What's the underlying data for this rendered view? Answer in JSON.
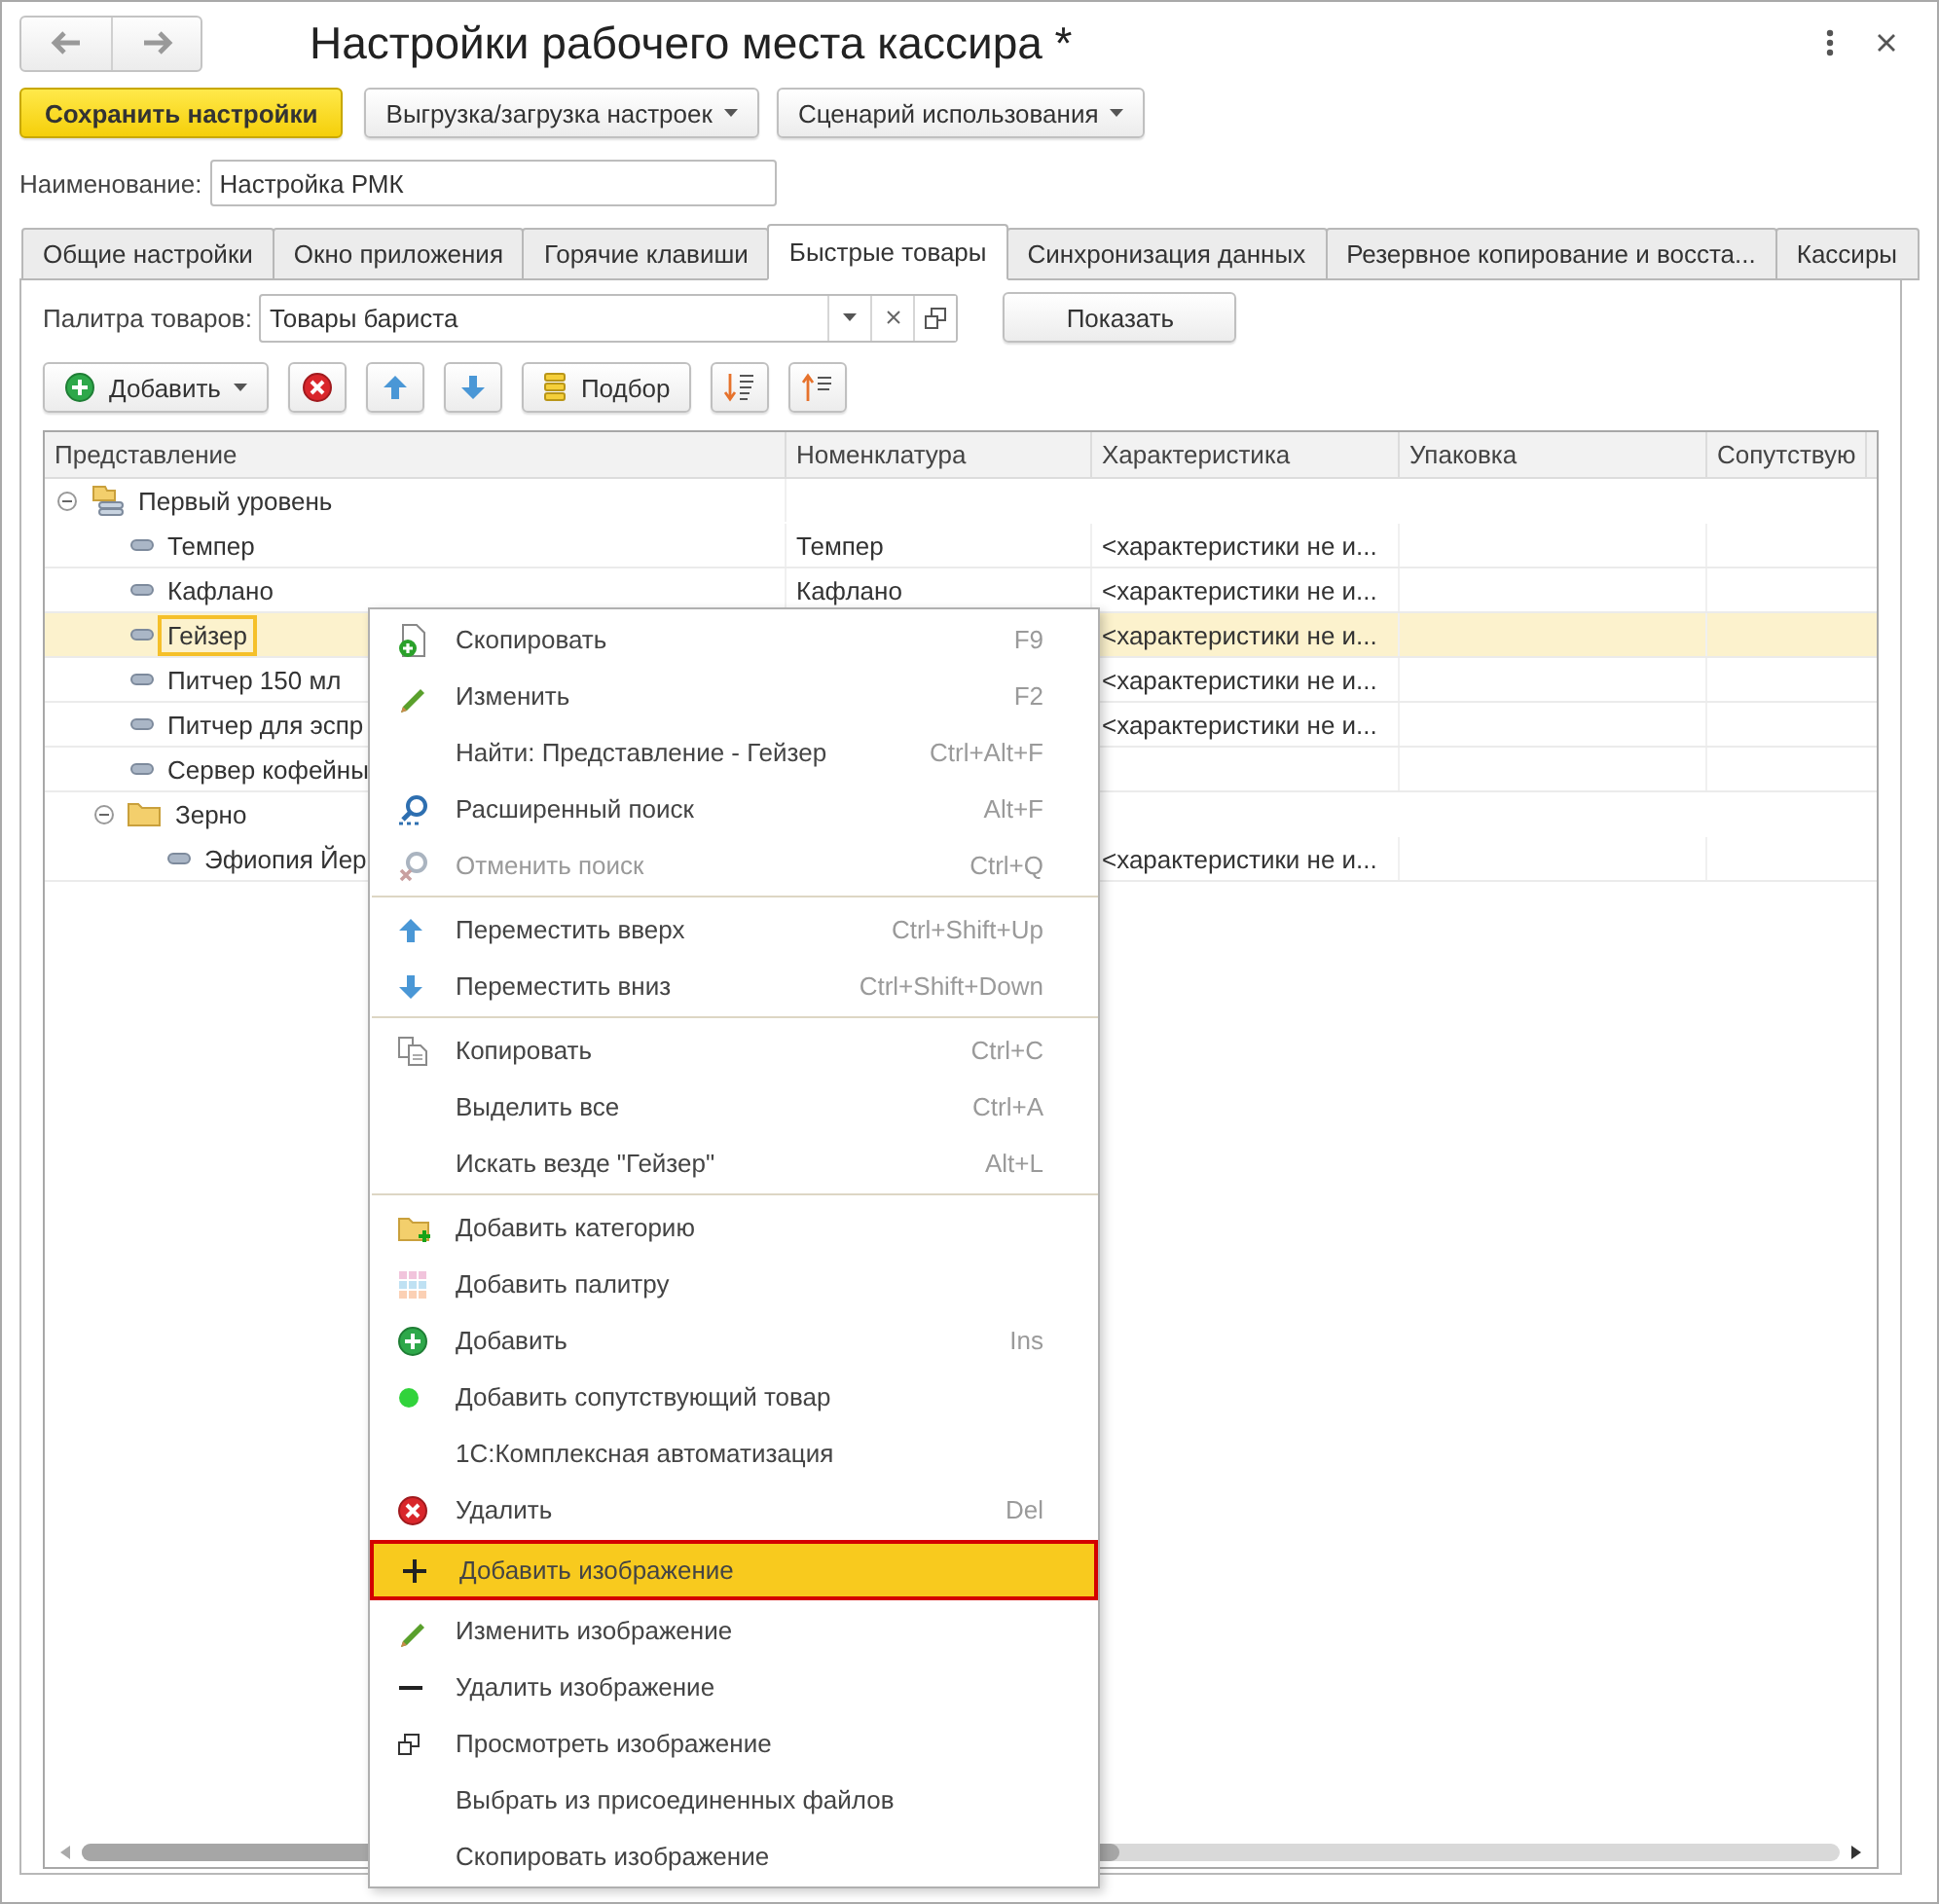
{
  "window": {
    "title": "Настройки рабочего места кассира *"
  },
  "toolbar": [
    {
      "kind": "primary",
      "label": "Сохранить настройки"
    },
    {
      "kind": "dropdown",
      "label": "Выгрузка/загрузка настроек"
    },
    {
      "kind": "dropdown",
      "label": "Сценарий использования"
    }
  ],
  "name_field": {
    "label": "Наименование:",
    "value": "Настройка РМК"
  },
  "tabs": [
    {
      "label": "Общие настройки",
      "selected": false
    },
    {
      "label": "Окно приложения",
      "selected": false
    },
    {
      "label": "Горячие клавиши",
      "selected": false
    },
    {
      "label": "Быстрые товары",
      "selected": true
    },
    {
      "label": "Синхронизация данных",
      "selected": false
    },
    {
      "label": "Резервное копирование и восста...",
      "selected": false
    },
    {
      "label": "Кассиры",
      "selected": false
    }
  ],
  "palette": {
    "label": "Палитра товаров:",
    "value": "Товары бариста",
    "button": "Показать"
  },
  "list_toolbar": [
    {
      "kind": "add",
      "label": "Добавить"
    },
    {
      "kind": "delete"
    },
    {
      "kind": "up"
    },
    {
      "kind": "down"
    },
    {
      "kind": "pick",
      "label": "Подбор"
    },
    {
      "kind": "sortdesc"
    },
    {
      "kind": "sortasc"
    }
  ],
  "table": {
    "columns": [
      "Представление",
      "Номенклатура",
      "Характеристика",
      "Упаковка",
      "Сопутствую"
    ],
    "rows": [
      {
        "kind": "group",
        "name": "Первый уровень",
        "expanded": true,
        "children": [
          {
            "kind": "item",
            "name": "Темпер",
            "nomenclature": "Темпер",
            "characteristic": "<характеристики не и...",
            "selected": false
          },
          {
            "kind": "item",
            "name": "Кафлано",
            "nomenclature": "Кафлано",
            "characteristic": "<характеристики не и...",
            "selected": false
          },
          {
            "kind": "item",
            "name": "Гейзер",
            "characteristic": "<характеристики не и...",
            "selected": true
          },
          {
            "kind": "item",
            "name": "Питчер 150 мл",
            "characteristic": "<характеристики не и...",
            "selected": false
          },
          {
            "kind": "item",
            "name": "Питчер для эспр",
            "characteristic": "<характеристики не и...",
            "selected": false
          },
          {
            "kind": "item",
            "name": "Сервер кофейны",
            "selected": false
          },
          {
            "kind": "group",
            "name": "Зерно",
            "expanded": true,
            "children": [
              {
                "kind": "item",
                "name": "Эфиопия Йер",
                "characteristic": "<характеристики не и...",
                "selected": false
              }
            ]
          }
        ]
      }
    ]
  },
  "context_menu": [
    {
      "kind": "duplicate",
      "label": "Скопировать",
      "shortcut": "F9",
      "disabled": false,
      "selected": false
    },
    {
      "kind": "edit",
      "label": "Изменить",
      "shortcut": "F2",
      "disabled": false,
      "selected": false
    },
    {
      "kind": "plain",
      "label": "Найти: Представление - Гейзер",
      "shortcut": "Ctrl+Alt+F",
      "disabled": false,
      "selected": false
    },
    {
      "kind": "search",
      "label": "Расширенный поиск",
      "shortcut": "Alt+F",
      "disabled": false,
      "selected": false
    },
    {
      "kind": "unsearch",
      "label": "Отменить поиск",
      "shortcut": "Ctrl+Q",
      "disabled": true,
      "selected": false
    },
    {
      "kind": "separator"
    },
    {
      "kind": "up",
      "label": "Переместить вверх",
      "shortcut": "Ctrl+Shift+Up",
      "disabled": false,
      "selected": false
    },
    {
      "kind": "down",
      "label": "Переместить вниз",
      "shortcut": "Ctrl+Shift+Down",
      "disabled": false,
      "selected": false
    },
    {
      "kind": "separator"
    },
    {
      "kind": "copy",
      "label": "Копировать",
      "shortcut": "Ctrl+C",
      "disabled": false,
      "selected": false
    },
    {
      "kind": "plain",
      "label": "Выделить все",
      "shortcut": "Ctrl+A",
      "disabled": false,
      "selected": false
    },
    {
      "kind": "plain",
      "label": "Искать везде \"Гейзер\"",
      "shortcut": "Alt+L",
      "disabled": false,
      "selected": false
    },
    {
      "kind": "separator"
    },
    {
      "kind": "category",
      "label": "Добавить категорию",
      "disabled": false,
      "selected": false
    },
    {
      "kind": "palette",
      "label": "Добавить палитру",
      "disabled": false,
      "selected": false
    },
    {
      "kind": "add",
      "label": "Добавить",
      "shortcut": "Ins",
      "disabled": false,
      "selected": false
    },
    {
      "kind": "related",
      "label": "Добавить сопутствующий товар",
      "disabled": false,
      "selected": false
    },
    {
      "kind": "plain",
      "label": "1С:Комплексная автоматизация",
      "disabled": false,
      "selected": false
    },
    {
      "kind": "delete",
      "label": "Удалить",
      "shortcut": "Del",
      "disabled": false,
      "selected": false
    },
    {
      "kind": "plus",
      "label": "Добавить изображение",
      "disabled": false,
      "selected": true
    },
    {
      "kind": "edit",
      "label": "Изменить изображение",
      "disabled": false,
      "selected": false
    },
    {
      "kind": "minus",
      "label": "Удалить изображение",
      "disabled": false,
      "selected": false
    },
    {
      "kind": "view",
      "label": "Просмотреть изображение",
      "disabled": false,
      "selected": false
    },
    {
      "kind": "plain",
      "label": "Выбрать из присоединенных файлов",
      "disabled": false,
      "selected": false
    },
    {
      "kind": "plain",
      "label": "Скопировать изображение",
      "disabled": false,
      "selected": false
    }
  ]
}
